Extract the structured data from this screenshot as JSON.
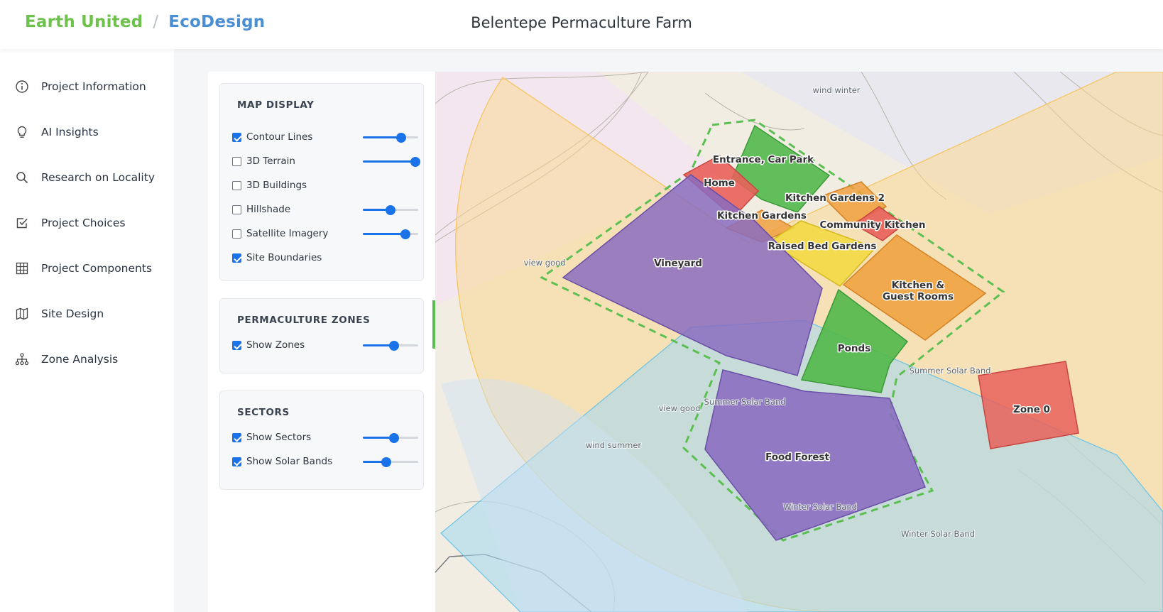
{
  "header": {
    "brand_primary": "Earth United",
    "brand_separator": "/",
    "brand_secondary": "EcoDesign",
    "title": "Belentepe Permaculture Farm"
  },
  "sidebar": {
    "items": [
      {
        "label": "Project Information",
        "icon": "info-icon"
      },
      {
        "label": "AI Insights",
        "icon": "lightbulb-icon"
      },
      {
        "label": "Research on Locality",
        "icon": "search-icon"
      },
      {
        "label": "Project Choices",
        "icon": "checkbox-icon"
      },
      {
        "label": "Project Components",
        "icon": "grid-icon"
      },
      {
        "label": "Site Design",
        "icon": "map-icon"
      },
      {
        "label": "Zone Analysis",
        "icon": "hierarchy-icon"
      }
    ]
  },
  "panel": {
    "map_display": {
      "title": "MAP DISPLAY",
      "layers": [
        {
          "label": "Contour Lines",
          "checked": true,
          "slider": 0.72
        },
        {
          "label": "3D Terrain",
          "checked": false,
          "slider": 1.0
        },
        {
          "label": "3D Buildings",
          "checked": false,
          "slider": null
        },
        {
          "label": "Hillshade",
          "checked": false,
          "slider": 0.5
        },
        {
          "label": "Satellite Imagery",
          "checked": false,
          "slider": 0.8
        },
        {
          "label": "Site Boundaries",
          "checked": true,
          "slider": null
        }
      ]
    },
    "permaculture_zones": {
      "title": "PERMACULTURE ZONES",
      "layers": [
        {
          "label": "Show Zones",
          "checked": true,
          "slider": 0.57
        }
      ]
    },
    "sectors": {
      "title": "SECTORS",
      "layers": [
        {
          "label": "Show Sectors",
          "checked": true,
          "slider": 0.57
        },
        {
          "label": "Show Solar Bands",
          "checked": true,
          "slider": 0.41
        }
      ]
    }
  },
  "map": {
    "colors": {
      "zone_red": "#e8605a",
      "zone_orange": "#f0a040",
      "zone_yellow": "#f2d83c",
      "zone_green": "#52b84a",
      "zone_purple": "#8a6cbf",
      "boundary": "#5cbf52",
      "summer_band": "#fbd58a",
      "winter_band": "#a9d8ef"
    },
    "zone_labels": {
      "entrance": "Entrance, Car Park",
      "home": "Home",
      "kitchen_gardens_2": "Kitchen Gardens 2",
      "kitchen_gardens": "Kitchen Gardens",
      "community_kitchen": "Community Kitchen",
      "raised_bed": "Raised Bed Gardens",
      "vineyard": "Vineyard",
      "kitchen_guest_1": "Kitchen &",
      "kitchen_guest_2": "Guest Rooms",
      "ponds": "Ponds",
      "zone0": "Zone 0",
      "food_forest": "Food Forest"
    },
    "sector_labels": {
      "wind_winter": "wind winter",
      "view_good_1": "view good",
      "view_good_2": "view good",
      "summer_band_1": "Summer Solar Band",
      "summer_band_2": "Summer Solar Band",
      "wind_summer": "wind summer",
      "winter_band_1": "Winter Solar Band",
      "winter_band_2": "Winter Solar Band"
    }
  }
}
